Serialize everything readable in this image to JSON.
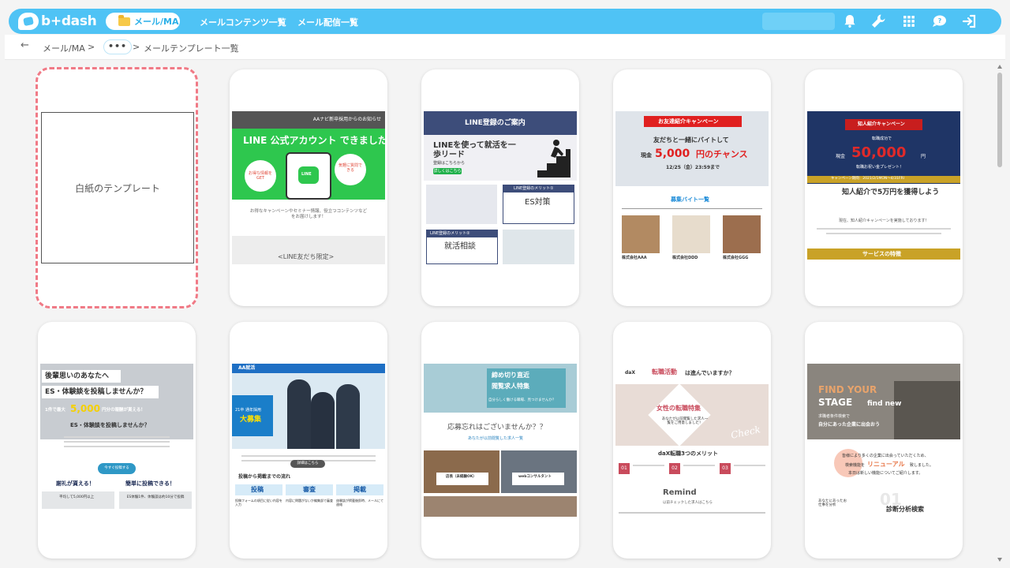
{
  "app": {
    "logo_text": "b+dash"
  },
  "nav": {
    "active_label": "メール/MA",
    "links": [
      "メールコンテンツ一覧",
      "メール配信一覧"
    ]
  },
  "breadcrumb": {
    "back": "←",
    "item1": "メール/MA",
    "sep": ">",
    "dots": "•••",
    "item3": "メールテンプレート一覧"
  },
  "templates": {
    "blank_label": "白紙のテンプレート",
    "t1": {
      "header": "AAナビ新卒採用からのお知らせ",
      "title": "LINE 公式アカウント できました",
      "bubble_left": "お得な情報をGET",
      "bubble_right": "気軽に質問できる",
      "line_logo": "LINE",
      "body": "お得なキャンペーンやセミナー情報、役立つコンテンツなどをお届けします！",
      "footer": "<LINE友だち限定>"
    },
    "t2": {
      "header": "LINE登録のご案内",
      "headline": "LINEを使って就活を一歩リード",
      "sub": "登録はこちらから",
      "btn": "詳しくはこちら",
      "merit1_label": "LINE登録のメリット①",
      "merit1": "ES対策",
      "merit2_label": "LINE登録のメリット②",
      "merit2": "就活相談"
    },
    "t3": {
      "banner": "お友達紹介キャンペーン",
      "line1": "友だちと一緒にバイトして",
      "amount_prefix": "現金",
      "amount": "5,000",
      "amount_suffix": "円のチャンス",
      "date": "12/25（金）23:59まで",
      "section": "募集バイト一覧",
      "c1": "株式会社AAA",
      "c2": "株式会社DDD",
      "c3": "株式会社GGG"
    },
    "t4": {
      "banner": "知人紹介キャンペーン",
      "line1": "転職成功で",
      "amount_prefix": "現金",
      "amount": "50,000",
      "amount_suffix": "円",
      "gift": "転職お祝い金プレゼント！",
      "period": "キャンペーン期間：2021/2/1MON〜4/31FRI",
      "headline": "知人紹介で5万円を獲得しよう",
      "body": "現在、知人紹介キャンペーンを実施しております！",
      "section": "サービスの特徴"
    },
    "t5": {
      "line1": "後輩思いのあなたへ",
      "line2": "ES・体験談を投稿しませんか？",
      "line3_prefix": "1件で最大",
      "amount": "5,000",
      "line3_suffix": "円分の報酬が貰える！",
      "headline": "ES・体験談を投稿しませんか？",
      "btn": "今すぐ投稿する",
      "left": "謝礼が貰える！",
      "right": "簡単に投稿できる！",
      "left_sub": "平均して5,000円以上",
      "right_sub": "ES体験1件、体験談は約10分で投稿"
    },
    "t6": {
      "brand": "AA就活",
      "badge_year": "21卒 通年採用",
      "badge": "大募集",
      "btn": "詳細はこちら",
      "section": "投稿から掲載までの流れ",
      "s1": "投稿",
      "s2": "審査",
      "s3": "掲載",
      "d1": "投稿フォームの項目に従い内容を入力",
      "d2": "内容に問題がないか編集部で審査",
      "d3": "体験談が掲載後即時、メールにて連絡"
    },
    "t7": {
      "banner1": "締め切り直近",
      "banner2": "閲覧求人特集",
      "banner_sub": "自分らしく働ける職場、見つけませんか？",
      "headline": "応募忘れはございませんか？？",
      "sub": "あなたが以前閲覧した求人一覧",
      "job1": "店長（未経験OK）",
      "job2": "webコンサルタント"
    },
    "t8": {
      "brand": "daX",
      "headline_em": "転職活動",
      "headline_rest": "は進んでいますか？",
      "special": "女性の転職特集",
      "special_sub": "あなたが以前閲覧した求人一覧をご用意しました！",
      "check": "Check",
      "merits": "daX転職3つのメリット",
      "m1": "01",
      "m2": "02",
      "m3": "03",
      "remind": "Remind",
      "remind_sub": "以前チェックした求人はこちら"
    },
    "t9": {
      "title1": "FIND YOUR",
      "title2": "STAGE",
      "title3": "find new",
      "sub1": "求職者条件検索で",
      "sub2": "自分にあった企業に出会おう",
      "body1": "皆様により多くの企業に出会っていただくため、",
      "body2_prefix": "検索機能を",
      "body2_em": "リニューアル",
      "body2_suffix": "致しました。",
      "body3": "本日は新しい機能についてご紹介します。",
      "num": "01",
      "feature": "診断分析検索",
      "feature_sub": "あなたにあったお仕事を分析"
    }
  }
}
